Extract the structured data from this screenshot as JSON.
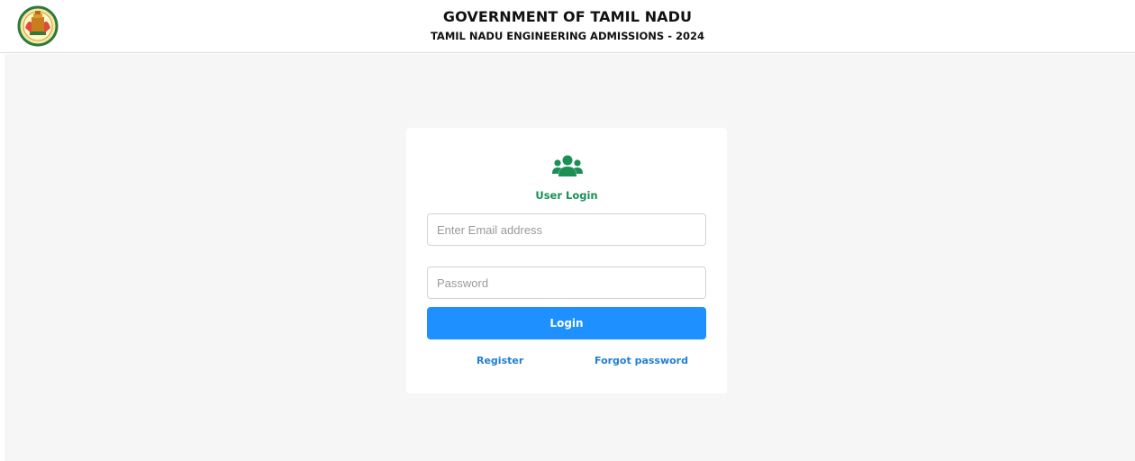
{
  "header": {
    "title": "GOVERNMENT OF TAMIL NADU",
    "subtitle": "TAMIL NADU ENGINEERING ADMISSIONS - 2024",
    "emblem_icon": "tamil-nadu-emblem"
  },
  "login": {
    "icon": "users-icon",
    "title": "User Login",
    "email_placeholder": "Enter Email address",
    "email_value": "",
    "password_placeholder": "Password",
    "password_value": "",
    "button_label": "Login",
    "register_label": "Register",
    "forgot_label": "Forgot password"
  },
  "colors": {
    "accent_green": "#1b8f55",
    "button_blue": "#1e90ff",
    "link_blue": "#1e7fd6",
    "background": "#f6f6f6"
  }
}
